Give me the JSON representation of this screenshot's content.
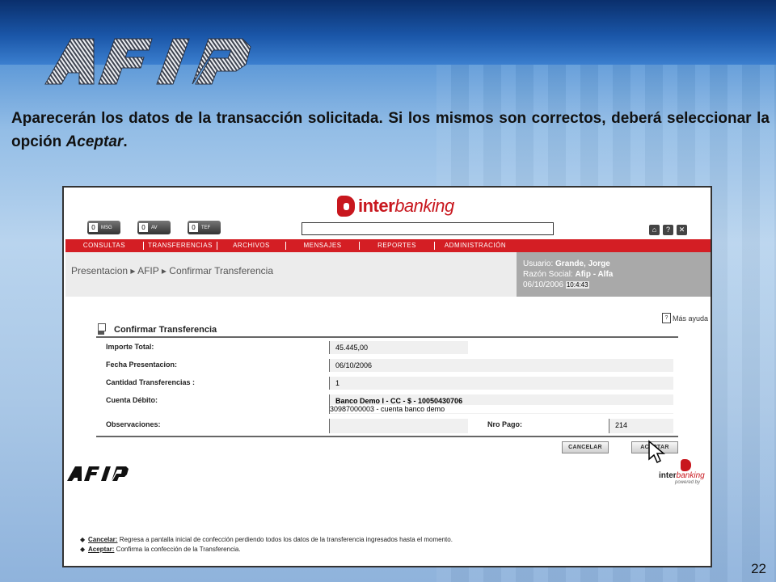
{
  "slide": {
    "intro_text": "Aparecerán los datos de la transacción solicitada. Si los mismos son correctos, deberá seleccionar la opción ",
    "intro_emph": "Aceptar",
    "intro_end": ".",
    "page_number": "22",
    "logo_text": "AFIP"
  },
  "app": {
    "brand_bold": "inter",
    "brand_italic": "banking",
    "message_buttons": [
      {
        "count": "0",
        "label": "MSG"
      },
      {
        "count": "0",
        "label": "AV"
      },
      {
        "count": "0",
        "label": "TEF"
      }
    ],
    "search": {
      "value": "",
      "placeholder": ""
    },
    "top_icons": [
      "home-icon",
      "help-icon",
      "close-icon"
    ],
    "menu": [
      "CONSULTAS",
      "TRANSFERENCIAS",
      "ARCHIVOS",
      "MENSAJES",
      "REPORTES",
      "ADMINISTRACIÓN"
    ],
    "breadcrumb": [
      "Presentacion",
      "AFIP",
      "Confirmar Transferencia"
    ],
    "user": {
      "usuario_label": "Usuario:",
      "usuario_value": "Grande, Jorge",
      "razon_label": "Razón Social:",
      "razon_value": "Afip - Alfa",
      "date": "06/10/2006",
      "time": "10:4:43"
    },
    "help_link": "Más ayuda",
    "form": {
      "title": "Confirmar Transferencia",
      "importe_label": "Importe Total:",
      "importe_value": "45.445,00",
      "fecha_label": "Fecha Presentacion:",
      "fecha_value": "06/10/2006",
      "cantidad_label": "Cantidad Transferencias :",
      "cantidad_value": "1",
      "cuenta_label": "Cuenta Débito:",
      "cuenta_value_line1": "Banco Demo I - CC - $ - 10050430706",
      "cuenta_value_line2": "30987000003 - cuenta banco demo",
      "observaciones_label": "Observaciones:",
      "observaciones_value": "",
      "nro_pago_label": "Nro Pago:",
      "nro_pago_value": "214"
    },
    "buttons": {
      "cancel": "CANCELAR",
      "accept": "ACEPTAR"
    },
    "footer_logo": "AFIP",
    "powered_brand_bold": "inter",
    "powered_brand_italic": "banking",
    "powered_by": "powered by",
    "notes": [
      {
        "term": "Cancelar:",
        "text": " Regresa a pantalla inicial de confección perdiendo todos los datos de la transferencia ingresados hasta el momento."
      },
      {
        "term": "Aceptar:",
        "text": " Confirma la confección de la Transferencia."
      }
    ]
  },
  "colors": {
    "menu_red": "#d41e24",
    "brand_red": "#c8171e",
    "user_panel": "#a9a9a9"
  }
}
